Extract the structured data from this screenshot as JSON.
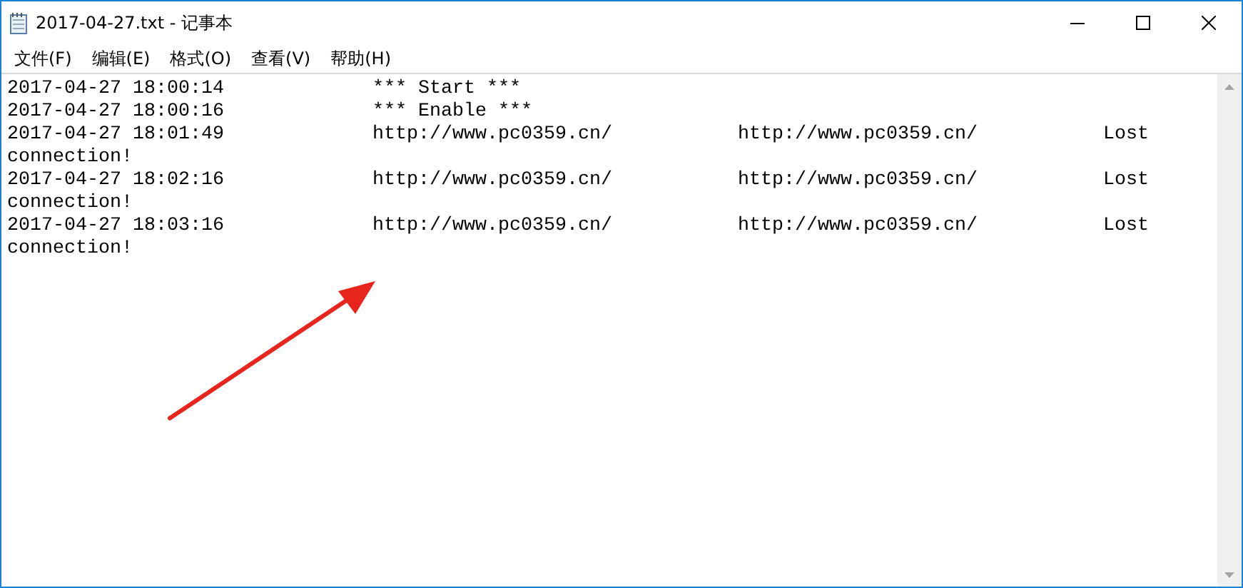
{
  "window": {
    "title": "2017-04-27.txt - 记事本"
  },
  "menu": [
    "文件(F)",
    "编辑(E)",
    "格式(O)",
    "查看(V)",
    "帮助(H)"
  ],
  "lines": [
    {
      "cells": [
        "2017-04-27 18:00:14",
        "*** Start ***"
      ]
    },
    {
      "cells": [
        "2017-04-27 18:00:16",
        "*** Enable ***"
      ]
    },
    {
      "cells": [
        "2017-04-27 18:01:49",
        "http://www.pc0359.cn/",
        "http://www.pc0359.cn/",
        "Lost"
      ],
      "continuation": "connection!"
    },
    {
      "cells": [
        "2017-04-27 18:02:16",
        "http://www.pc0359.cn/",
        "http://www.pc0359.cn/",
        "Lost"
      ],
      "continuation": "connection!"
    },
    {
      "cells": [
        "2017-04-27 18:03:16",
        "http://www.pc0359.cn/",
        "http://www.pc0359.cn/",
        "Lost"
      ],
      "continuation": "connection!"
    }
  ]
}
